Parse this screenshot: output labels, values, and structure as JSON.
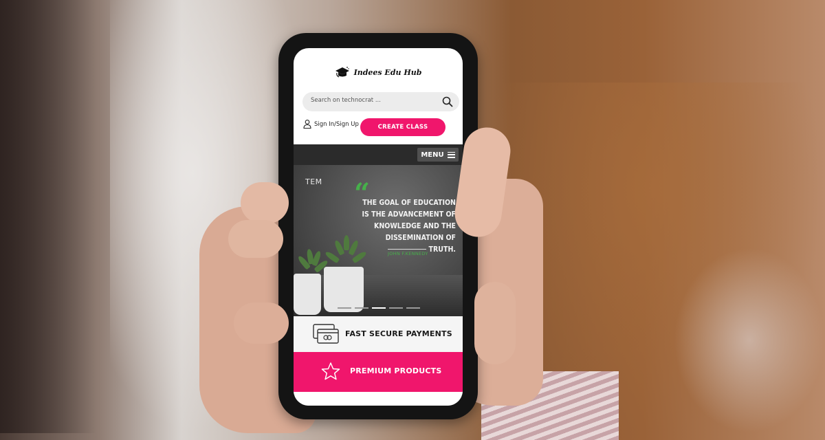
{
  "site": {
    "name": "Indees Edu Hub"
  },
  "search": {
    "placeholder": "Search on technocrat ..."
  },
  "header": {
    "signin_label": "Sign In/Sign Up",
    "create_class_label": "CREATE CLASS"
  },
  "nav": {
    "menu_label": "MENU"
  },
  "hero": {
    "brand_mark": "TEM",
    "quote": "The goal of education is the advancement of knowledge and the dissemination of truth.",
    "author": "JOHN F.KENNEDY",
    "slides_total": 5,
    "active_slide": 3
  },
  "features": {
    "payments_label": "FAST SECURE PAYMENTS",
    "premium_label": "PREMIUM PRODUCTS"
  },
  "colors": {
    "accent": "#f0166c",
    "quote_green": "#46b04a",
    "menubar": "#2b2b2b"
  },
  "icons": [
    "graduation-cap-icon",
    "search-icon",
    "user-icon",
    "hamburger-icon",
    "credit-card-icon",
    "star-icon"
  ]
}
